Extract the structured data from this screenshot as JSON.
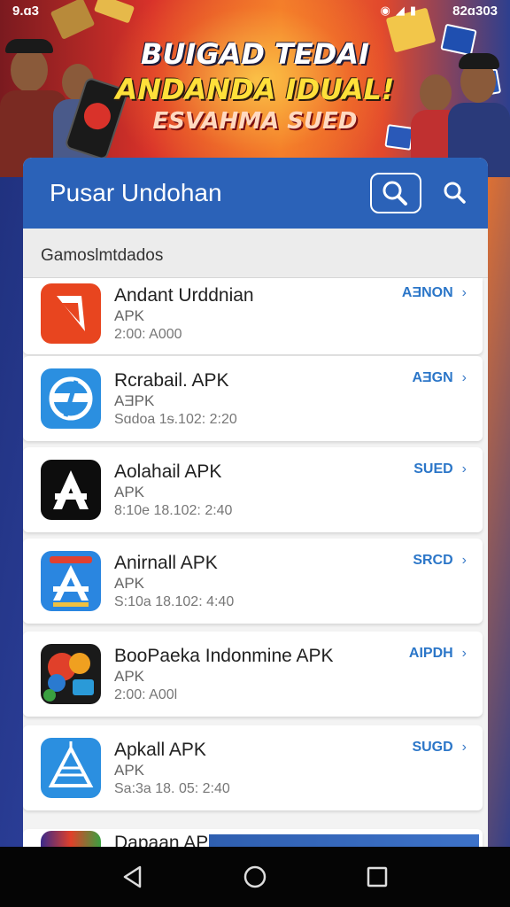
{
  "status_bar": {
    "time": "9.ɑ3",
    "right": "82ɑ303"
  },
  "banner": {
    "line1": "BUIGAD TEDAI",
    "line2": "ANDANDA IDUAL!",
    "line3": "ESVAHMA SUED"
  },
  "appbar": {
    "title": "Pusar Undohan"
  },
  "section": {
    "title": "Gamoslmtdados"
  },
  "apps": [
    {
      "name": "Andant Urddnian",
      "type": "APK",
      "meta": "2:00: A000",
      "action": "AƎNON",
      "icon": "pdf-app-icon"
    },
    {
      "name": "Rcrabail. APK",
      "type": "AƎPK",
      "meta": "Sɑdoa 1ᵴ.102: 2:20",
      "action": "AƎGN",
      "icon": "link-app-icon"
    },
    {
      "name": "Aolahail APK",
      "type": "APK",
      "meta": "8:10e 18.102: 2:40",
      "action": "SUED",
      "icon": "font-app-icon"
    },
    {
      "name": "Anirnall APK",
      "type": "APK",
      "meta": "S:10a 18.102: 4:40",
      "action": "SRCD",
      "icon": "appstore-app-icon"
    },
    {
      "name": "BooPaeka  Indonmine APK",
      "type": "APK",
      "meta": "2:00: A00l",
      "action": "AIPDH",
      "icon": "game-app-icon"
    },
    {
      "name": "Apkall APK",
      "type": "APK",
      "meta": "Sa:3a 18. 05: 2:40",
      "action": "SUGD",
      "icon": "triangle-app-icon"
    },
    {
      "name": "Dapaan APK",
      "type": "",
      "meta": "",
      "action": "",
      "icon": "partial-app-icon"
    }
  ],
  "colors": {
    "appbar": "#2b62b8",
    "action_text": "#2b76c8"
  }
}
